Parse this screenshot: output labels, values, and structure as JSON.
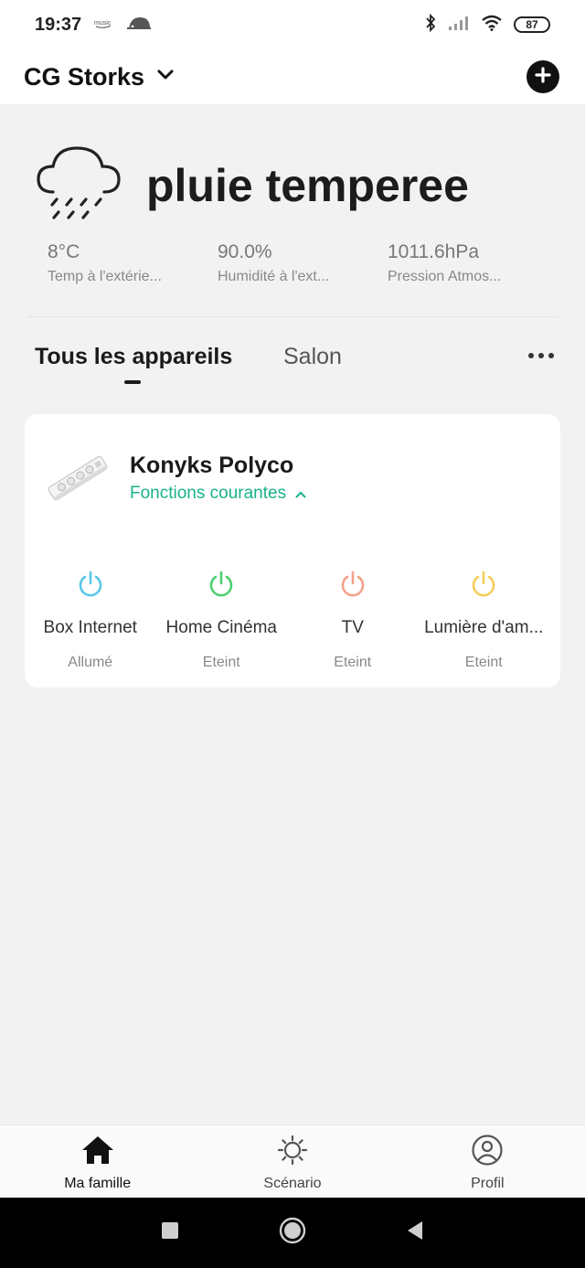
{
  "status_bar": {
    "time": "19:37",
    "battery": "87",
    "icons": [
      "amazon-music-icon",
      "hedgehog-icon",
      "bluetooth-icon",
      "signal-icon",
      "wifi-icon",
      "battery-icon"
    ]
  },
  "header": {
    "home_name": "CG Storks",
    "dropdown_icon": "chevron-down-icon",
    "add_icon": "plus-circle-icon"
  },
  "weather": {
    "icon": "rain-cloud-icon",
    "condition": "pluie temperee",
    "stats": [
      {
        "value": "8°C",
        "label": "Temp à l'extérie..."
      },
      {
        "value": "90.0%",
        "label": "Humidité à l'ext..."
      },
      {
        "value": "1011.6hPa",
        "label": "Pression Atmos..."
      }
    ]
  },
  "tabs": {
    "items": [
      {
        "label": "Tous les appareils",
        "active": true
      },
      {
        "label": "Salon",
        "active": false
      }
    ],
    "more_icon": "more-horizontal-icon"
  },
  "device": {
    "name": "Konyks Polyco",
    "functions_label": "Fonctions courantes",
    "accent": "#19b28a",
    "switches": [
      {
        "name": "Box Internet",
        "state": "Allumé",
        "color": "#5bc7e6"
      },
      {
        "name": "Home Cinéma",
        "state": "Eteint",
        "color": "#4fcf70"
      },
      {
        "name": "TV",
        "state": "Eteint",
        "color": "#f2a28a"
      },
      {
        "name": "Lumière d'am...",
        "state": "Eteint",
        "color": "#f4cd5a"
      }
    ]
  },
  "bottom_nav": {
    "items": [
      {
        "label": "Ma famille",
        "icon": "home-icon",
        "active": true
      },
      {
        "label": "Scénario",
        "icon": "sun-icon",
        "active": false
      },
      {
        "label": "Profil",
        "icon": "user-circle-icon",
        "active": false
      }
    ]
  }
}
